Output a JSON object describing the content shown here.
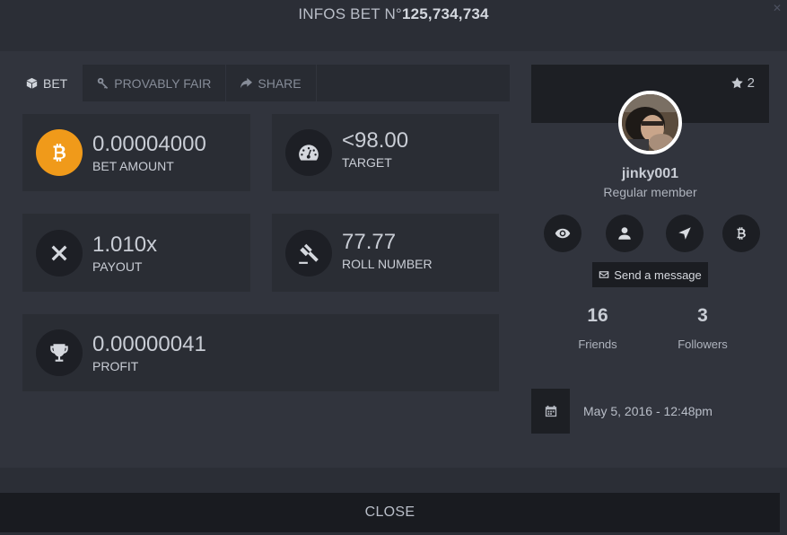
{
  "modal": {
    "title_prefix": "INFOS BET N°",
    "bet_number": "125,734,734",
    "close_label": "CLOSE"
  },
  "tabs": [
    {
      "label": "BET",
      "icon": "cube-icon",
      "active": true
    },
    {
      "label": "PROVABLY FAIR",
      "icon": "key-icon",
      "active": false
    },
    {
      "label": "SHARE",
      "icon": "share-icon",
      "active": false
    }
  ],
  "bet": {
    "bet_amount": {
      "value": "0.00004000",
      "label": "BET AMOUNT",
      "icon": "bitcoin-icon"
    },
    "target": {
      "value": "<98.00",
      "label": "TARGET",
      "icon": "gauge-icon"
    },
    "payout": {
      "value": "1.010x",
      "label": "PAYOUT",
      "icon": "times-icon"
    },
    "roll_number": {
      "value": "77.77",
      "label": "ROLL NUMBER",
      "icon": "gavel-icon"
    },
    "profit": {
      "value": "0.00000041",
      "label": "PROFIT",
      "icon": "trophy-icon"
    }
  },
  "profile": {
    "stars": "2",
    "username": "jinky001",
    "rank": "Regular member",
    "actions": [
      "eye-icon",
      "user-icon",
      "location-arrow-icon",
      "bitcoin-icon"
    ],
    "send_message_label": "Send a message",
    "friends_count": "16",
    "friends_label": "Friends",
    "followers_count": "3",
    "followers_label": "Followers"
  },
  "bet_date": "May 5, 2016 - 12:48pm",
  "colors": {
    "background": "#2b2e36",
    "panel": "#31343d",
    "card": "#2a2d34",
    "bitcoin_orange": "#f09a1a"
  }
}
